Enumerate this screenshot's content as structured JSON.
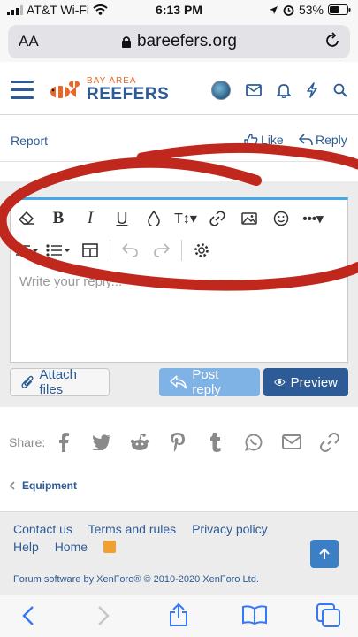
{
  "status_bar": {
    "carrier": "AT&T Wi-Fi",
    "time": "6:13 PM",
    "battery": "53%"
  },
  "browser": {
    "aa_label": "AA",
    "host": "bareefers.org"
  },
  "site": {
    "logo_line1": "BAY AREA",
    "logo_line2": "REEFERS"
  },
  "post_actions": {
    "report": "Report",
    "like": "Like",
    "reply": "Reply"
  },
  "editor": {
    "placeholder": "Write your reply..."
  },
  "buttons": {
    "attach": "Attach files",
    "post_reply": "Post reply",
    "preview": "Preview"
  },
  "share": {
    "label": "Share:",
    "icons": [
      "facebook-icon",
      "twitter-icon",
      "reddit-icon",
      "pinterest-icon",
      "tumblr-icon",
      "whatsapp-icon",
      "email-icon",
      "link-icon"
    ]
  },
  "breadcrumb": {
    "item": "Equipment"
  },
  "footer": {
    "links": [
      "Contact us",
      "Terms and rules",
      "Privacy policy",
      "Help",
      "Home"
    ],
    "copyright": "Forum software by XenForo® © 2010-2020 XenForo Ltd."
  },
  "colors": {
    "brand_blue": "#2d5b96",
    "brand_orange": "#e06a28",
    "post_reply_bg": "#7fb3e6",
    "annotation_red": "#c0281e"
  }
}
